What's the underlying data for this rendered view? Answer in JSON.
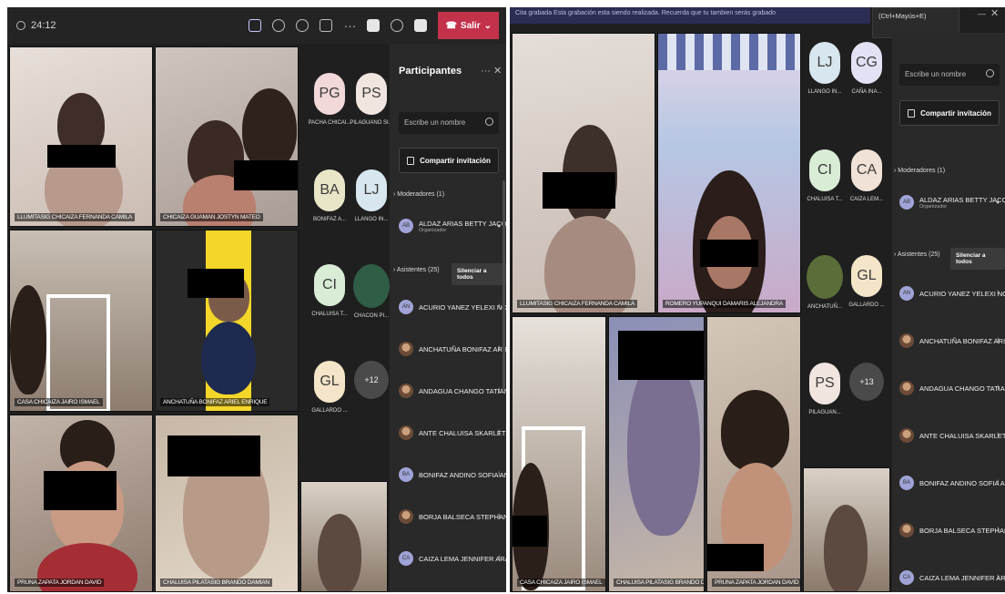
{
  "left": {
    "timer": "24:12",
    "leave_label": "Salir",
    "tiles": [
      "LLUMITASIG CHICAIZA FERNANDA CAMILA",
      "CHICAIZA GUAMAN JOSTYN MATEO",
      "CASA CHICAIZA JAIRO ISMAEL",
      "ANCHATUÑA BONIFAZ ARIEL ENRIQUE",
      "PRUNA ZAPATA JORDAN DAVID",
      "CHALUISA PILATASIG BRANDO DAMIAN"
    ],
    "gallery": [
      {
        "initials": "PG",
        "name": "PACHA CHICAI...",
        "color": "#f2d8d8"
      },
      {
        "initials": "PS",
        "name": "PILAGUANO SI...",
        "color": "#f1e6df"
      },
      {
        "initials": "BA",
        "name": "BONIFAZ A...",
        "color": "#e9e6c8"
      },
      {
        "initials": "LJ",
        "name": "LLANGO IN...",
        "color": "#d8e6ef"
      },
      {
        "initials": "CI",
        "name": "CHALUISA T...",
        "color": "#d9ecd6"
      },
      {
        "initials": "",
        "name": "CHACON PI...",
        "color": "#2f5d45"
      },
      {
        "initials": "GL",
        "name": "GALLARDO ...",
        "color": "#f4e5c8"
      },
      {
        "initials": "+12",
        "name": "",
        "color": "#4a4a4a"
      }
    ],
    "panel": {
      "title": "Participantes",
      "search_placeholder": "Escribe un nombre",
      "share_label": "Compartir invitación",
      "moderators_label": "Moderadores (1)",
      "moderator": {
        "initials": "AB",
        "name": "ALDAZ ARIAS BETTY JACQUE...",
        "role": "Organizador"
      },
      "attendees_label": "Asistentes (25)",
      "mute_all_label": "Silenciar a todos",
      "attendees": [
        {
          "initials": "AN",
          "name": "ACURIO YANEZ YELEXI NOELIA"
        },
        {
          "initials": "",
          "name": "ANCHATUÑA BONIFAZ ARIEL..."
        },
        {
          "initials": "",
          "name": "ANDAGUA CHANGO TATIAN..."
        },
        {
          "initials": "",
          "name": "ANTE CHALUISA SKARLET YURI"
        },
        {
          "initials": "BA",
          "name": "BONIFAZ ANDINO SOFIA AN..."
        },
        {
          "initials": "",
          "name": "BORJA BALSECA STEPHANY K..."
        },
        {
          "initials": "CA",
          "name": "CAIZA LEMA JENNIFER ARAC..."
        }
      ]
    }
  },
  "right": {
    "banner": "Cita grabada  Esta grabación esta siendo realizada. Recuerda que tu tambien serás grabado",
    "tooltip": "(Ctrl+Mayús+E)",
    "tiles": [
      "LLUMITASIG CHICAIZA FERNANDA CAMILA",
      "ROMERO YUPANQUI DAMARIS ALEJANDRA",
      "CASA CHICAIZA JAIRO ISMAEL",
      "CHALUISA PILATASIG BRANDO DAM...",
      "PRUNA ZAPATA JORDAN DAVID"
    ],
    "gallery": [
      {
        "initials": "LJ",
        "name": "LLANGO IN...",
        "color": "#d8e6ef"
      },
      {
        "initials": "CG",
        "name": "CAÑA INA...",
        "color": "#e2e2f4"
      },
      {
        "initials": "CI",
        "name": "CHALUISA T...",
        "color": "#d9ecd6"
      },
      {
        "initials": "CA",
        "name": "CAIZA LEM...",
        "color": "#f0e2d6"
      },
      {
        "initials": "",
        "name": "ANCHATUÑ...",
        "color": "#5b6e3a"
      },
      {
        "initials": "GL",
        "name": "GALLARDO ...",
        "color": "#f4e5c8"
      },
      {
        "initials": "PS",
        "name": "PILAGUAN...",
        "color": "#f1e6df"
      },
      {
        "initials": "+13",
        "name": "",
        "color": "#4a4a4a"
      }
    ],
    "panel": {
      "search_placeholder": "Escribe un nombre",
      "share_label": "Compartir invitación",
      "moderators_label": "Moderadores (1)",
      "moderator": {
        "initials": "AB",
        "name": "ALDAZ ARIAS BETTY JACQUE...",
        "role": "Organizador"
      },
      "attendees_label": "Asistentes (25)",
      "mute_all_label": "Silenciar a todos",
      "attendees": [
        {
          "initials": "AN",
          "name": "ACURIO YANEZ YELEXI NOELIA"
        },
        {
          "initials": "",
          "name": "ANCHATUÑA BONIFAZ ARIEL..."
        },
        {
          "initials": "",
          "name": "ANDAGUA CHANGO TATIAN..."
        },
        {
          "initials": "",
          "name": "ANTE CHALUISA SKARLET YURI"
        },
        {
          "initials": "BA",
          "name": "BONIFAZ ANDINO SOFIA AN..."
        },
        {
          "initials": "",
          "name": "BORJA BALSECA STEPHANY K..."
        },
        {
          "initials": "CA",
          "name": "CAIZA LEMA JENNIFER ARAC..."
        }
      ]
    }
  }
}
